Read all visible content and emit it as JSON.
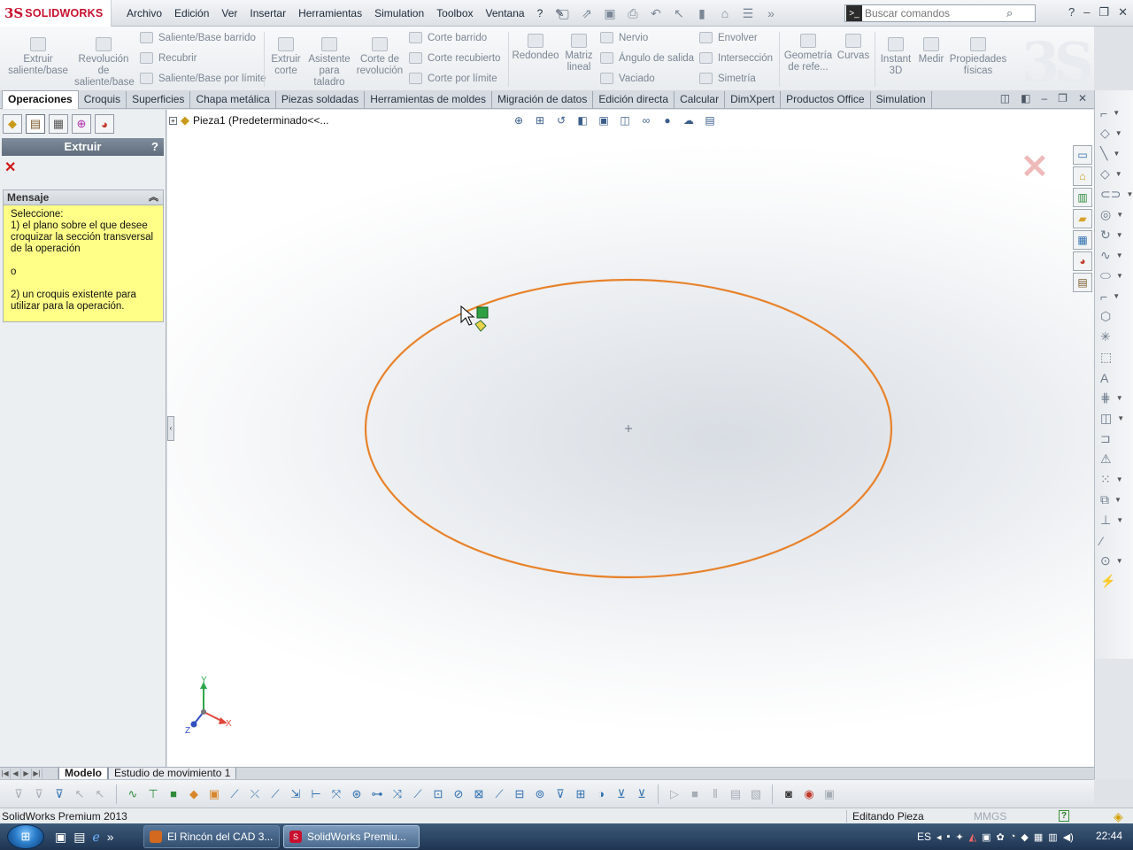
{
  "app": {
    "logo_mark": "3S",
    "logo_text": "SOLIDWORKS",
    "menus": [
      "Archivo",
      "Edición",
      "Ver",
      "Insertar",
      "Herramientas",
      "Simulation",
      "Toolbox",
      "Ventana",
      "?"
    ],
    "search_placeholder": "Buscar comandos",
    "help_glyph": "?"
  },
  "commands": {
    "extruir_saliente": "Extruir saliente/base",
    "revolucion_saliente": "Revolución de saliente/base",
    "saliente_barrido": "Saliente/Base barrido",
    "recubrir": "Recubrir",
    "saliente_limite": "Saliente/Base por límite",
    "extruir_corte": "Extruir corte",
    "asistente_taladro": "Asistente para taladro",
    "corte_revolucion": "Corte de revolución",
    "corte_barrido": "Corte barrido",
    "corte_recubierto": "Corte recubierto",
    "corte_limite": "Corte por límite",
    "redondeo": "Redondeo",
    "matriz_lineal": "Matriz lineal",
    "nervio": "Nervio",
    "angulo_salida": "Ángulo de salida",
    "vaciado": "Vaciado",
    "envolver": "Envolver",
    "interseccion": "Intersección",
    "simetria": "Simetría",
    "geometria_ref": "Geometría de refe...",
    "curvas": "Curvas",
    "instant3d": "Instant 3D",
    "medir": "Medir",
    "propiedades_fisicas": "Propiedades físicas"
  },
  "tabs": [
    {
      "label": "Operaciones",
      "active": true
    },
    {
      "label": "Croquis"
    },
    {
      "label": "Superficies"
    },
    {
      "label": "Chapa metálica"
    },
    {
      "label": "Piezas soldadas"
    },
    {
      "label": "Herramientas de moldes"
    },
    {
      "label": "Migración de datos"
    },
    {
      "label": "Edición directa"
    },
    {
      "label": "Calcular"
    },
    {
      "label": "DimXpert"
    },
    {
      "label": "Productos Office"
    },
    {
      "label": "Simulation"
    }
  ],
  "property_manager": {
    "title": "Extruir",
    "help": "?",
    "message_header": "Mensaje",
    "message_lines": [
      "Seleccione:",
      "1) el plano sobre el que desee croquizar la sección transversal de la operación",
      "o",
      "2) un croquis existente para utilizar para la operación."
    ]
  },
  "tree": {
    "expander": "+",
    "root": "Pieza1  (Predeterminado<<..."
  },
  "triad": {
    "x": "X",
    "y": "Y",
    "z": "Z"
  },
  "model_tabs": [
    {
      "label": "Modelo",
      "active": true
    },
    {
      "label": "Estudio de movimiento 1"
    }
  ],
  "status": {
    "product": "SolidWorks Premium 2013",
    "mode": "Editando Pieza",
    "units": "MMGS"
  },
  "taskbar": {
    "tasks": [
      {
        "label": "El Rincón del CAD 3...",
        "icon": "firefox-icon"
      },
      {
        "label": "SolidWorks Premiu...",
        "icon": "solidworks-icon",
        "active": true
      }
    ],
    "language": "ES",
    "clock": "22:44"
  },
  "colors": {
    "sketch_ellipse": "#e8822a",
    "brand_red": "#c8102e",
    "message_bg": "#ffff88",
    "pm_title_bg": "#6f7d8c"
  }
}
